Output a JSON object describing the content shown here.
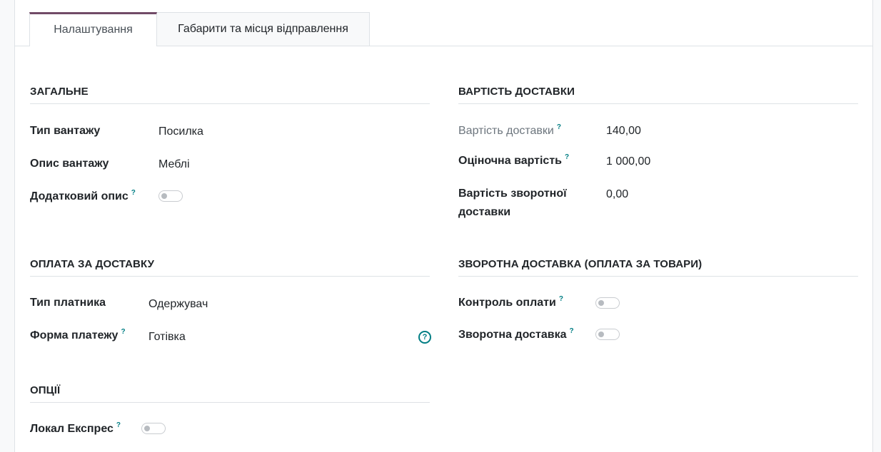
{
  "tabs": [
    {
      "label": "Налаштування"
    },
    {
      "label": "Габарити та місця відправлення"
    }
  ],
  "help_mark": "?",
  "general": {
    "title": "ЗАГАЛЬНЕ",
    "cargo_type_label": "Тип вантажу",
    "cargo_type_value": "Посилка",
    "cargo_desc_label": "Опис вантажу",
    "cargo_desc_value": "Меблі",
    "extra_desc_label": "Додатковий опис",
    "extra_desc_enabled": false
  },
  "delivery_cost": {
    "title": "ВАРТІСТЬ ДОСТАВКИ",
    "cost_label": "Вартість доставки",
    "cost_value": "140,00",
    "estimated_label": "Оціночна вартість",
    "estimated_value": "1 000,00",
    "return_cost_label_line1": "Вартість зворотної",
    "return_cost_label_line2": "доставки",
    "return_cost_value": "0,00"
  },
  "payment": {
    "title": "ОПЛАТА ЗА ДОСТАВКУ",
    "payer_label": "Тип платника",
    "payer_value": "Одержувач",
    "form_label": "Форма платежу",
    "form_value": "Готівка"
  },
  "return_delivery": {
    "title": "ЗВОРОТНА ДОСТАВКА (ОПЛАТА ЗА ТОВАРИ)",
    "payment_control_label": "Контроль оплати",
    "payment_control_enabled": false,
    "return_label": "Зворотна доставка",
    "return_enabled": false
  },
  "options": {
    "title": "ОПЦІЇ",
    "local_express_label": "Локал Експрес",
    "local_express_enabled": false
  },
  "colors": {
    "tab_accent": "#714b67",
    "help_teal": "#017e84"
  }
}
